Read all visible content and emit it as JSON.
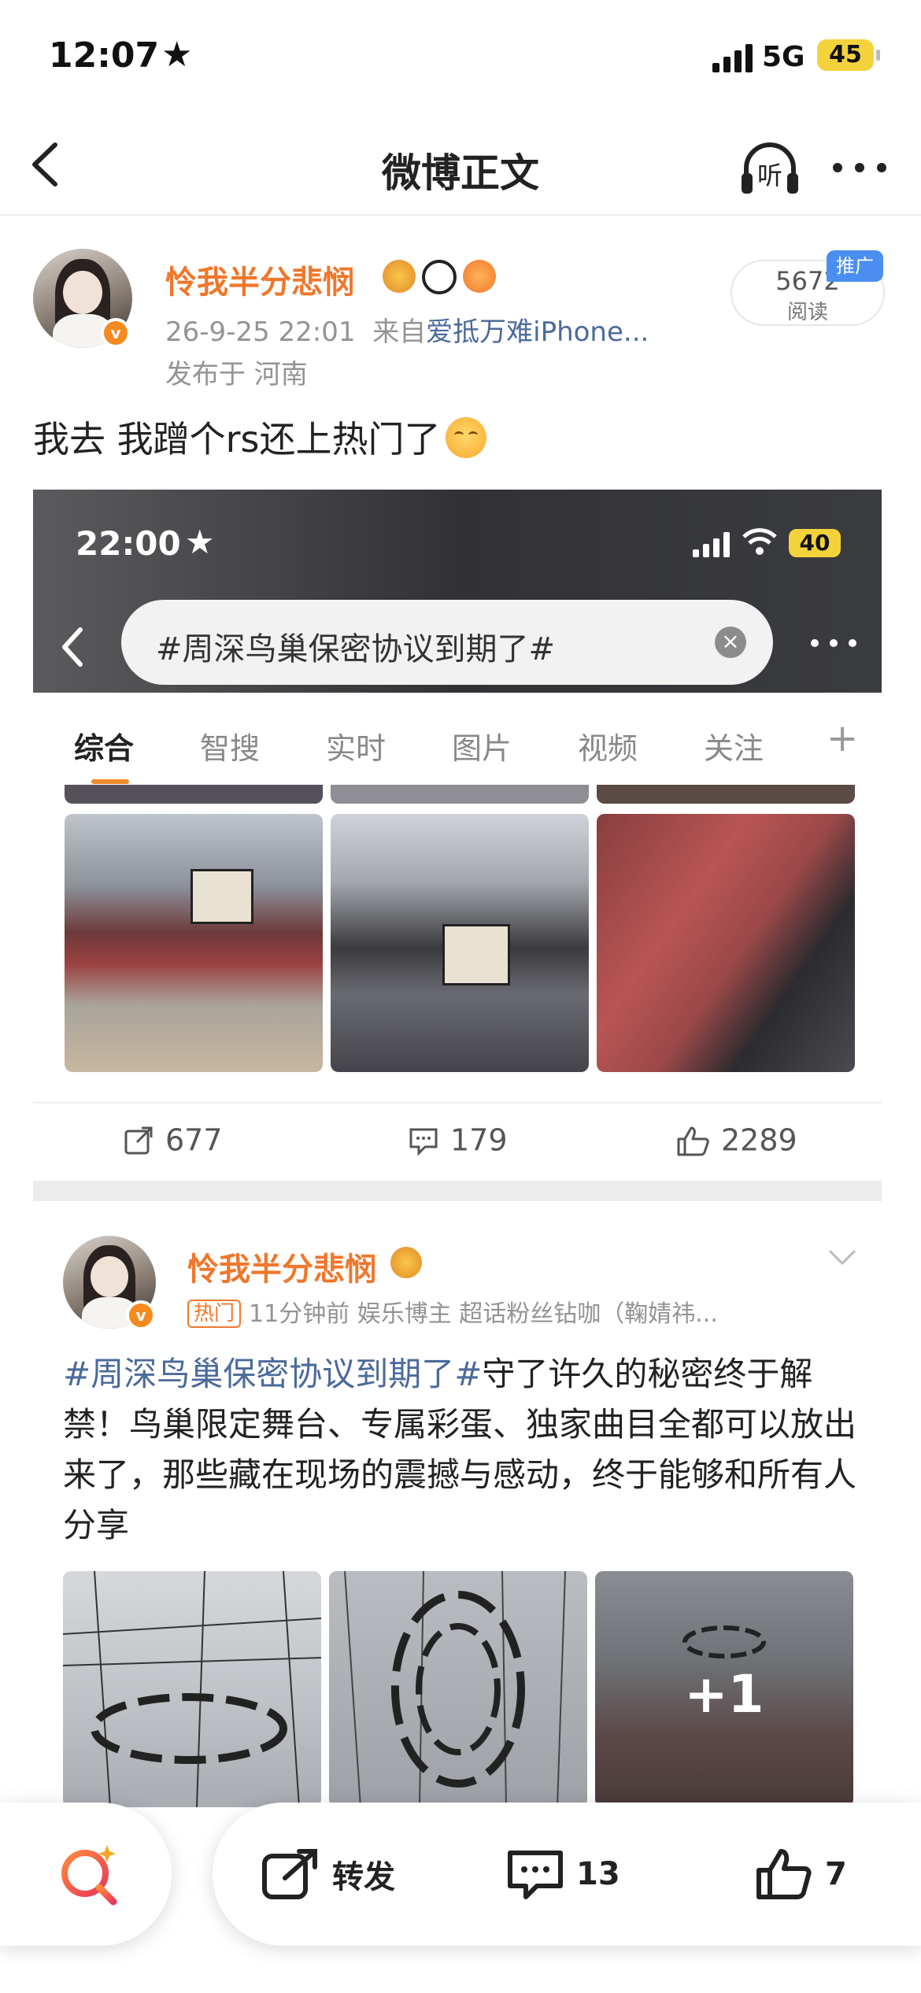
{
  "status_bar": {
    "time": "12:07",
    "network": "5G",
    "battery": "45"
  },
  "nav": {
    "title": "微博正文",
    "listen_label": "听"
  },
  "post": {
    "username": "怜我半分悲悯",
    "date": "26-9-25 22:01",
    "source_prefix": "来自",
    "source": "爱抵万难iPhone...",
    "location": "发布于 河南",
    "read_count": "5672",
    "read_label": "阅读",
    "promo_badge": "推广",
    "text": "我去 我蹭个rs还上热门了"
  },
  "embedded": {
    "time": "22:00",
    "battery": "40",
    "search_query": "#周深鸟巢保密协议到期了#",
    "tabs": [
      "综合",
      "智搜",
      "实时",
      "图片",
      "视频",
      "关注"
    ],
    "plus": "+",
    "actions": {
      "repost": "677",
      "comment": "179",
      "like": "2289"
    }
  },
  "post2": {
    "username": "怜我半分悲悯",
    "hot_tag": "热门",
    "meta": "11分钟前  娱乐博主 超话粉丝钻咖（鞠婧祎...",
    "topic": "#周深鸟巢保密协议到期了#",
    "text": "守了许久的秘密终于解禁！鸟巢限定舞台、专属彩蛋、独家曲目全都可以放出来了，那些藏在现场的震撼与感动，终于能够和所有人分享",
    "extra_images": "+1",
    "ghost_count": "2"
  },
  "bottom_bar": {
    "repost_label": "转发",
    "comment_count": "13",
    "like_count": "7"
  },
  "colors": {
    "accent": "#f0772c",
    "link": "#4b6a9b",
    "badge": "#4a8ff0"
  }
}
